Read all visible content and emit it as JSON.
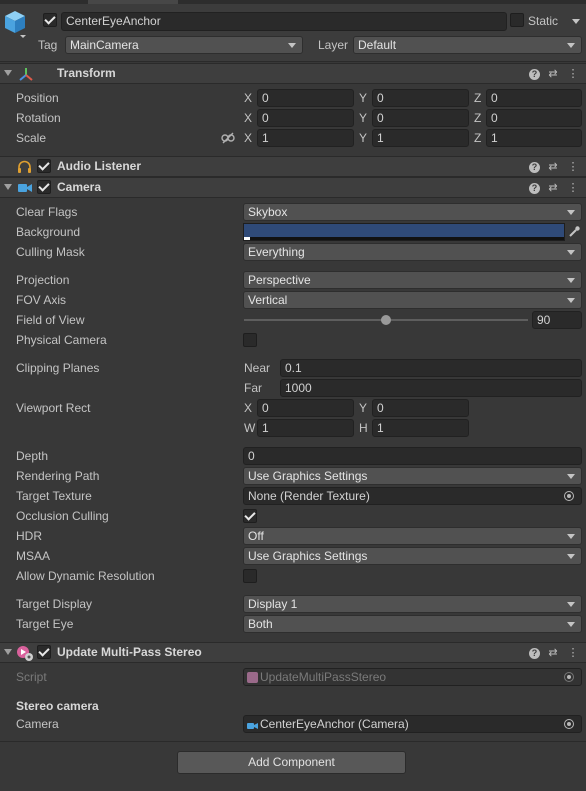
{
  "object": {
    "name": "CenterEyeAnchor",
    "static_label": "Static",
    "tag_label": "Tag",
    "tag_value": "MainCamera",
    "layer_label": "Layer",
    "layer_value": "Default"
  },
  "transform": {
    "title": "Transform",
    "position_label": "Position",
    "rotation_label": "Rotation",
    "scale_label": "Scale",
    "position": {
      "x": "0",
      "y": "0",
      "z": "0"
    },
    "rotation": {
      "x": "0",
      "y": "0",
      "z": "0"
    },
    "scale": {
      "x": "1",
      "y": "1",
      "z": "1"
    },
    "axis": {
      "x": "X",
      "y": "Y",
      "z": "Z"
    }
  },
  "audio_listener": {
    "title": "Audio Listener"
  },
  "camera": {
    "title": "Camera",
    "clear_flags_label": "Clear Flags",
    "clear_flags": "Skybox",
    "background_label": "Background",
    "background_color": "#2f4a78",
    "culling_mask_label": "Culling Mask",
    "culling_mask": "Everything",
    "projection_label": "Projection",
    "projection": "Perspective",
    "fov_axis_label": "FOV Axis",
    "fov_axis": "Vertical",
    "field_of_view_label": "Field of View",
    "field_of_view": "90",
    "physical_camera_label": "Physical Camera",
    "clipping_planes_label": "Clipping Planes",
    "near_label": "Near",
    "near": "0.1",
    "far_label": "Far",
    "far": "1000",
    "viewport_rect_label": "Viewport Rect",
    "viewport": {
      "x": "0",
      "y": "0",
      "w": "1",
      "h": "1"
    },
    "viewport_axis": {
      "x": "X",
      "y": "Y",
      "w": "W",
      "h": "H"
    },
    "depth_label": "Depth",
    "depth": "0",
    "rendering_path_label": "Rendering Path",
    "rendering_path": "Use Graphics Settings",
    "target_texture_label": "Target Texture",
    "target_texture": "None (Render Texture)",
    "occlusion_culling_label": "Occlusion Culling",
    "hdr_label": "HDR",
    "hdr": "Off",
    "msaa_label": "MSAA",
    "msaa": "Use Graphics Settings",
    "allow_dynamic_resolution_label": "Allow Dynamic Resolution",
    "target_display_label": "Target Display",
    "target_display": "Display 1",
    "target_eye_label": "Target Eye",
    "target_eye": "Both"
  },
  "update_stereo": {
    "title": "Update Multi-Pass Stereo",
    "script_label": "Script",
    "script": "UpdateMultiPassStereo",
    "section_label": "Stereo camera",
    "camera_label": "Camera",
    "camera_value": "CenterEyeAnchor (Camera)"
  },
  "add_component_label": "Add Component",
  "colors": {
    "background": "#383838",
    "header": "#3e3e3e",
    "field": "#2a2a2a",
    "dropdown": "#515151",
    "cube_icon": "#4aa3df",
    "transform_x": "#e05a4a",
    "transform_y": "#5ec25e",
    "transform_z": "#4a8fe0"
  }
}
